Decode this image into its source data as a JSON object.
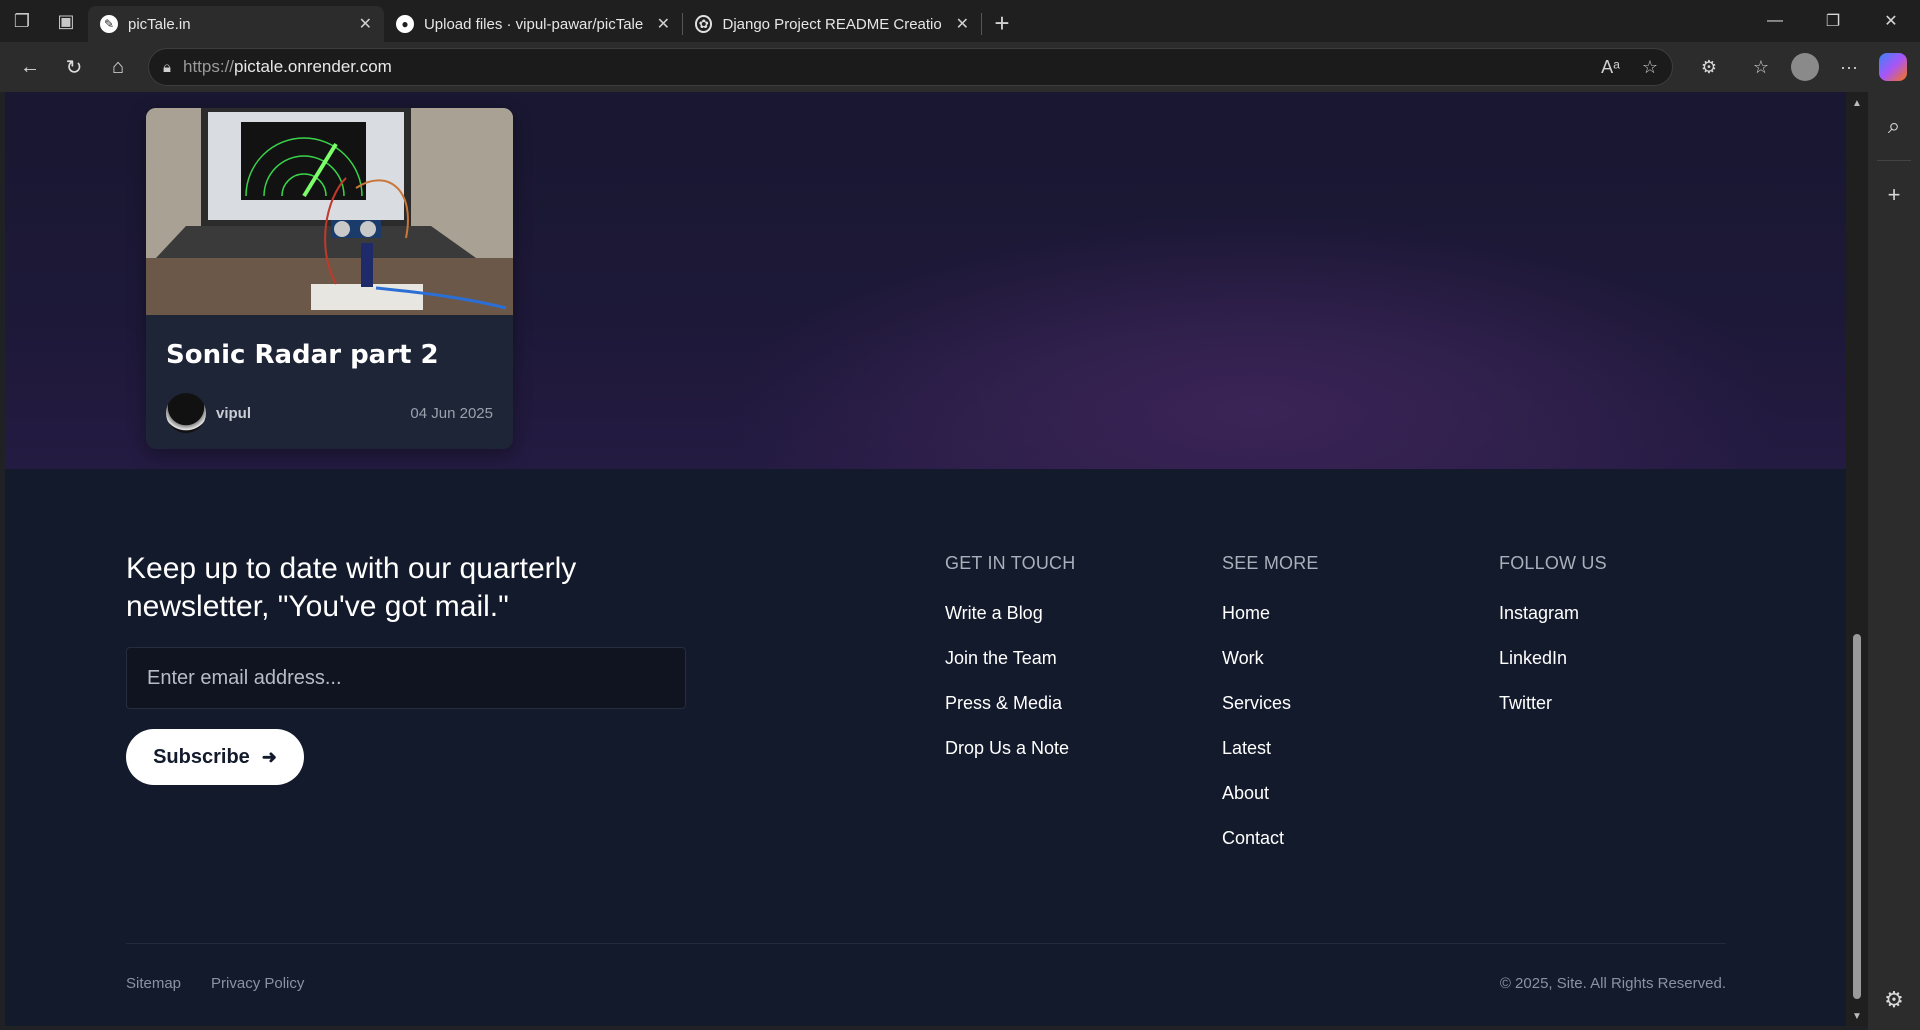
{
  "browser": {
    "tabs": [
      {
        "title": "picTale.in",
        "active": true,
        "icon": "pictale-favicon"
      },
      {
        "title": "Upload files · vipul-pawar/picTale",
        "active": false,
        "icon": "github-icon"
      },
      {
        "title": "Django Project README Creation",
        "active": false,
        "icon": "openai-icon"
      }
    ],
    "url_prefix": "https://",
    "url_host": "pictale.onrender.com"
  },
  "post": {
    "title": "Sonic Radar part 2",
    "author": "vipul",
    "date": "04 Jun 2025"
  },
  "newsletter": {
    "title": "Keep up to date with our quarterly newsletter, \"You've got mail.\"",
    "email_placeholder": "Enter email address...",
    "subscribe_label": "Subscribe"
  },
  "footer": {
    "columns": [
      {
        "heading": "GET IN TOUCH",
        "links": [
          "Write a Blog",
          "Join the Team",
          "Press & Media",
          "Drop Us a Note"
        ]
      },
      {
        "heading": "SEE MORE",
        "links": [
          "Home",
          "Work",
          "Services",
          "Latest",
          "About",
          "Contact"
        ]
      },
      {
        "heading": "FOLLOW US",
        "links": [
          "Instagram",
          "LinkedIn",
          "Twitter"
        ]
      }
    ],
    "bottom_links": [
      "Sitemap",
      "Privacy Policy"
    ],
    "copyright": "© 2025, Site. All Rights Reserved."
  }
}
